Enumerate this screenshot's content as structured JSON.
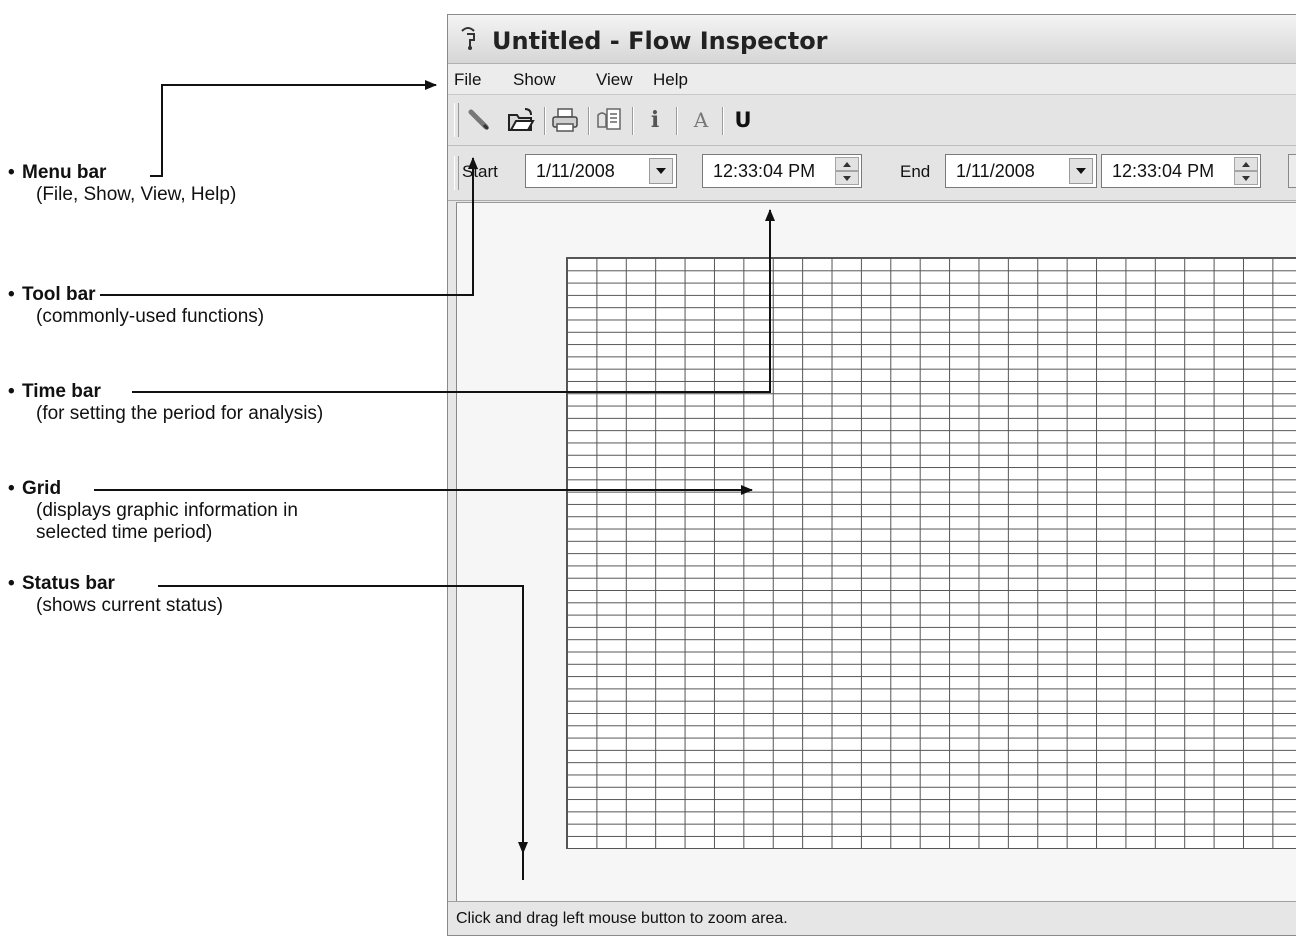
{
  "annotations": [
    {
      "title": "Menu bar",
      "desc": "(File, Show, View, Help)"
    },
    {
      "title": "Tool bar",
      "desc": "(commonly-used functions)"
    },
    {
      "title": "Time bar",
      "desc": "(for setting the period for analysis)"
    },
    {
      "title": "Grid",
      "desc": "(displays graphic information in\n selected time period)"
    },
    {
      "title": "Status bar",
      "desc": "(shows current status)"
    }
  ],
  "window": {
    "title": "Untitled - Flow Inspector",
    "menu": [
      "File",
      "Show",
      "View",
      "Help"
    ],
    "toolbar_icons": [
      "new-pencil-icon",
      "open-folder-icon",
      "print-icon",
      "properties-icon",
      "info-icon",
      "font-icon",
      "underline-icon"
    ],
    "info_glyph": "i",
    "font_glyph": "A",
    "underline_glyph": "U",
    "timebar": {
      "start_label": "Start",
      "start_date": "1/11/2008",
      "start_time": "12:33:04 PM",
      "end_label": "End",
      "end_date": "1/11/2008",
      "end_time": "12:33:04 PM"
    },
    "status": "Click and drag left mouse button to zoom area."
  }
}
